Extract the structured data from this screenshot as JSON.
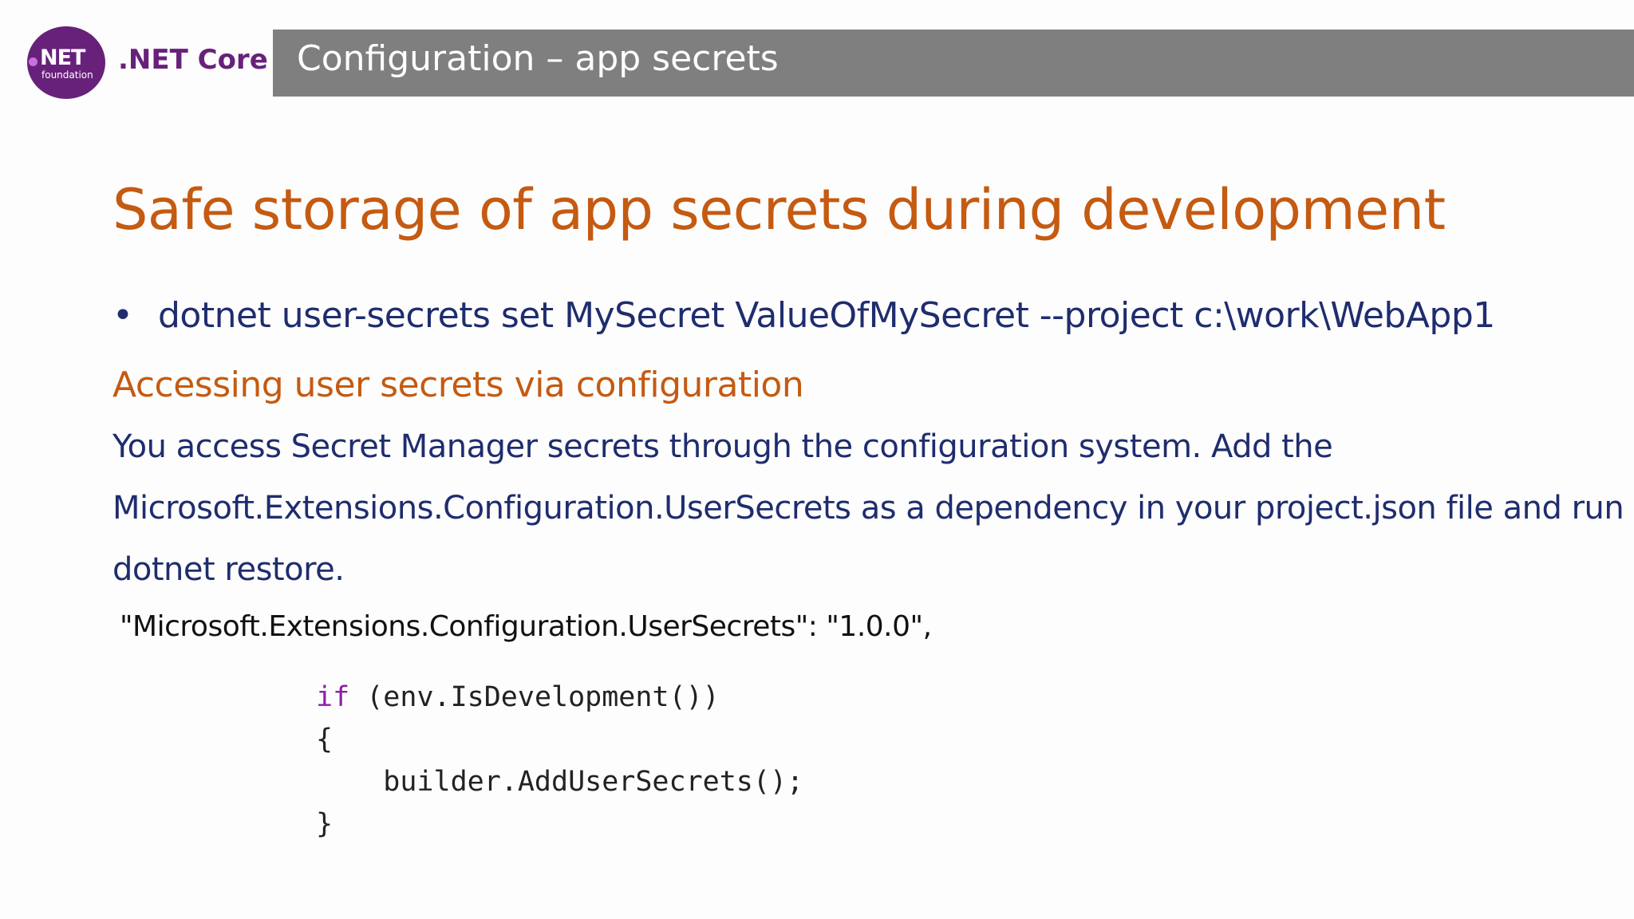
{
  "header": {
    "logo": {
      "net_text": "NET",
      "foundation_text": "foundation",
      "color": "#68217a"
    },
    "brand_label": ".NET Core",
    "title": "Configuration – app secrets",
    "title_bar_color": "#7f7f7f"
  },
  "content": {
    "heading": "Safe storage of app secrets during development",
    "bullets": [
      "dotnet user-secrets set MySecret ValueOfMySecret --project c:\\work\\WebApp1"
    ],
    "subheading": "Accessing user secrets via configuration",
    "paragraph_lines": [
      "You access Secret Manager secrets through the configuration system. Add the",
      "Microsoft.Extensions.Configuration.UserSecrets as a dependency in your project.json file and run",
      "dotnet restore."
    ],
    "dependency_line": "\"Microsoft.Extensions.Configuration.UserSecrets\": \"1.0.0\",",
    "code": {
      "keyword": "if",
      "line1_rest": " (env.IsDevelopment())",
      "line2": "{",
      "line3": "    builder.AddUserSecrets();",
      "line4": "}"
    }
  },
  "colors": {
    "heading": "#c55a11",
    "body_text": "#1f2d6e",
    "code_keyword": "#8b1fa8"
  }
}
